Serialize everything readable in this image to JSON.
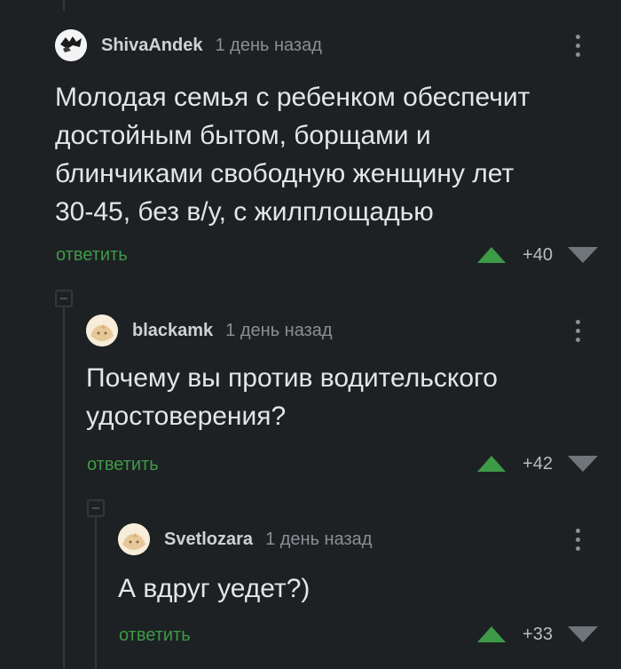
{
  "comments": [
    {
      "username": "ShivaAndek",
      "time": "1 день назад",
      "text": "Молодая семья с ребенком обеспечит\nдостойным бытом, борщами и\nблинчиками свободную женщину лет\n30-45, без в/у, с жилплощадью",
      "reply_label": "ответить",
      "score": "+40"
    },
    {
      "username": "blackamk",
      "time": "1 день назад",
      "text": "Почему вы против водительского\nудостоверения?",
      "reply_label": "ответить",
      "score": "+42"
    },
    {
      "username": "Svetlozara",
      "time": "1 день назад",
      "text": "А вдруг уедет?)",
      "reply_label": "ответить",
      "score": "+33"
    }
  ],
  "colors": {
    "background": "#1e2124",
    "reply": "#3d9a47",
    "upvote": "#3d9a47",
    "downvote": "#70757a"
  }
}
